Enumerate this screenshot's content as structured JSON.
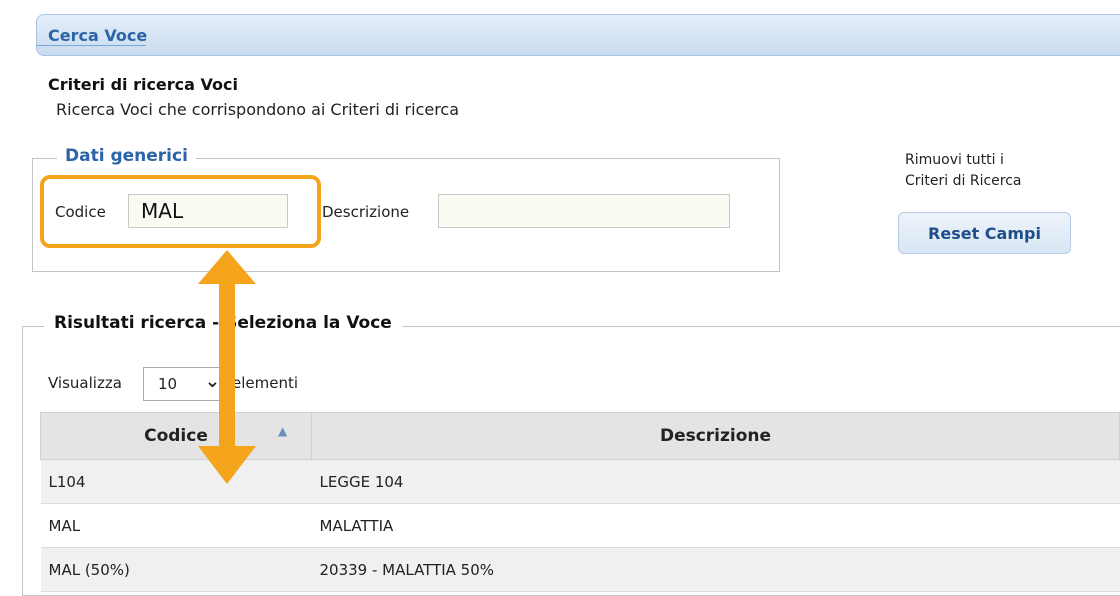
{
  "header": {
    "title": "Cerca Voce"
  },
  "criteria": {
    "title": "Criteri di ricerca Voci",
    "subtitle": "Ricerca Voci che corrispondono ai Criteri di ricerca"
  },
  "generic": {
    "legend": "Dati generici",
    "codice_label": "Codice",
    "codice_value": "MAL",
    "descrizione_label": "Descrizione",
    "descrizione_value": ""
  },
  "reset": {
    "note_line1": "Rimuovi tutti i",
    "note_line2": "Criteri di Ricerca",
    "button": "Reset Campi"
  },
  "results": {
    "legend": "Risultati ricerca - Seleziona la Voce",
    "show_label": "Visualizza",
    "page_size": "10",
    "elements_label": "elementi",
    "columns": [
      "Codice",
      "Descrizione"
    ],
    "rows": [
      [
        "L104",
        "LEGGE 104"
      ],
      [
        "MAL",
        "MALATTIA"
      ],
      [
        "MAL (50%)",
        "20339 - MALATTIA 50%"
      ]
    ]
  },
  "colors": {
    "accent": "#f4a51c",
    "link": "#2b64a8"
  },
  "icons": {
    "sort": "sort-asc-icon",
    "dropdown": "chevron-down-icon"
  }
}
